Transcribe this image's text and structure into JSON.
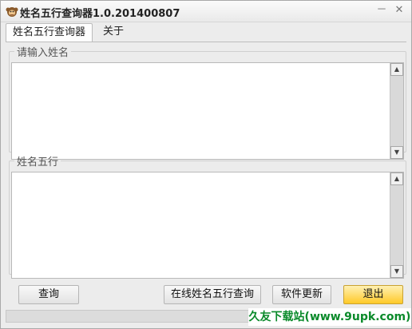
{
  "window": {
    "title": "姓名五行查询器1.0.201400807",
    "minimize_glyph": "－",
    "close_glyph": "✕",
    "app_icon": "monkey-icon"
  },
  "tabs": [
    {
      "label": "姓名五行查询器",
      "active": true
    },
    {
      "label": "关于",
      "active": false
    }
  ],
  "input_group": {
    "legend": "请输入姓名",
    "value": ""
  },
  "output_group": {
    "legend": "姓名五行",
    "value": ""
  },
  "buttons": {
    "query": "查询",
    "online_query": "在线姓名五行查询",
    "update": "软件更新",
    "exit": "退出"
  },
  "colors": {
    "exit_button": "#ffc928",
    "watermark_text": "#0a8a2a"
  },
  "watermark": "久友下载站(www.9upk.com)"
}
